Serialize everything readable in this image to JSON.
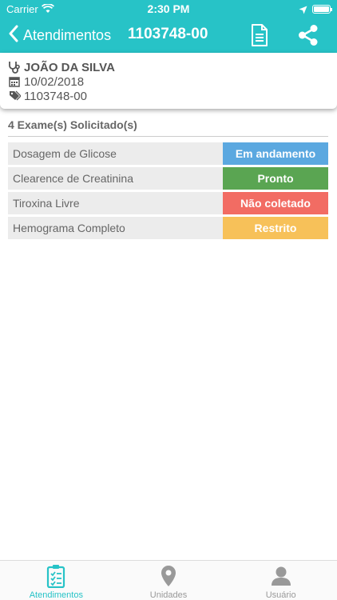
{
  "status_bar": {
    "carrier": "Carrier",
    "time": "2:30 PM"
  },
  "nav": {
    "back_label": "Atendimentos",
    "title": "1103748-00"
  },
  "patient": {
    "name": "JOÃO DA SILVA",
    "date": "10/02/2018",
    "code": "1103748-00"
  },
  "exams": {
    "header": "4 Exame(s) Solicitado(s)",
    "items": [
      {
        "name": "Dosagem de Glicose",
        "status": "Em andamento",
        "color": "#5ba8e0"
      },
      {
        "name": "Clearence de Creatinina",
        "status": "Pronto",
        "color": "#5aa552"
      },
      {
        "name": "Tiroxina Livre",
        "status": "Não coletado",
        "color": "#f26c63"
      },
      {
        "name": "Hemograma Completo",
        "status": "Restrito",
        "color": "#f7c159"
      }
    ]
  },
  "tabs": [
    {
      "label": "Atendimentos",
      "icon": "clipboard-check-icon"
    },
    {
      "label": "Unidades",
      "icon": "map-pin-icon"
    },
    {
      "label": "Usuário",
      "icon": "user-icon"
    }
  ],
  "colors": {
    "primary": "#27c3c7",
    "tab_inactive": "#999999"
  }
}
